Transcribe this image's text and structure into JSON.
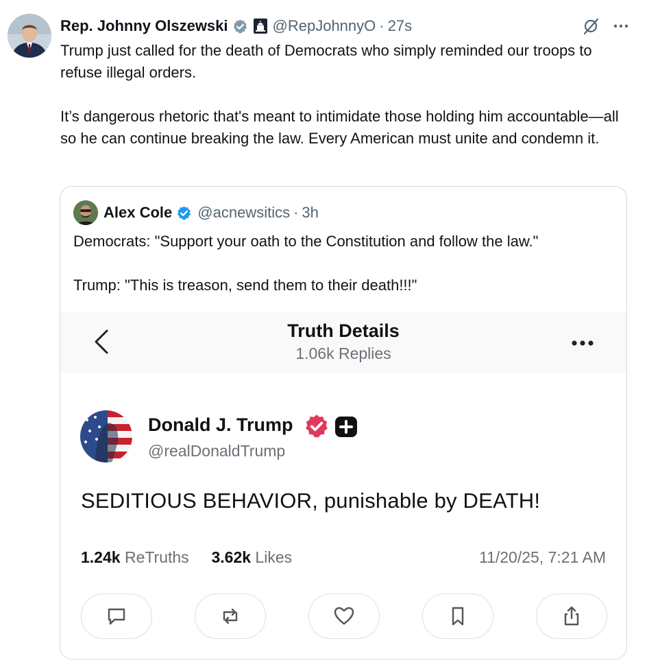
{
  "tweet": {
    "author_name": "Rep. Johnny Olszewski",
    "handle": "@RepJohnnyO",
    "separator": "·",
    "time": "27s",
    "paragraphs": [
      "Trump just called for the death of Democrats who simply reminded our troops to refuse illegal orders.",
      "It’s dangerous rhetoric that's meant to intimidate those holding him accountable—all so he can continue breaking the law. Every American must unite and condemn it."
    ]
  },
  "quote": {
    "author_name": "Alex Cole",
    "handle": "@acnewsitics",
    "separator": "·",
    "time": "3h",
    "paragraphs": [
      "Democrats: \"Support your oath to the Constitution and follow the law.\"",
      "Trump: \"This is treason, send them to their death!!!\""
    ]
  },
  "media": {
    "title": "Truth Details",
    "subtitle": "1.06k Replies",
    "author_name": "Donald J. Trump",
    "handle": "@realDonaldTrump",
    "post_text": "SEDITIOUS BEHAVIOR, punishable by DEATH!",
    "retruths_count": "1.24k",
    "retruths_label": "ReTruths",
    "likes_count": "3.62k",
    "likes_label": "Likes",
    "date": "11/20/25, 7:21 AM",
    "actions": [
      "reply-icon",
      "retruth-icon",
      "like-icon",
      "bookmark-icon",
      "share-icon"
    ]
  },
  "colors": {
    "verified_blue": "#1d9bf0",
    "verified_gray": "#829aab",
    "truth_badge": "#e0395a",
    "text_primary": "#0f1419",
    "text_secondary": "#536471"
  }
}
